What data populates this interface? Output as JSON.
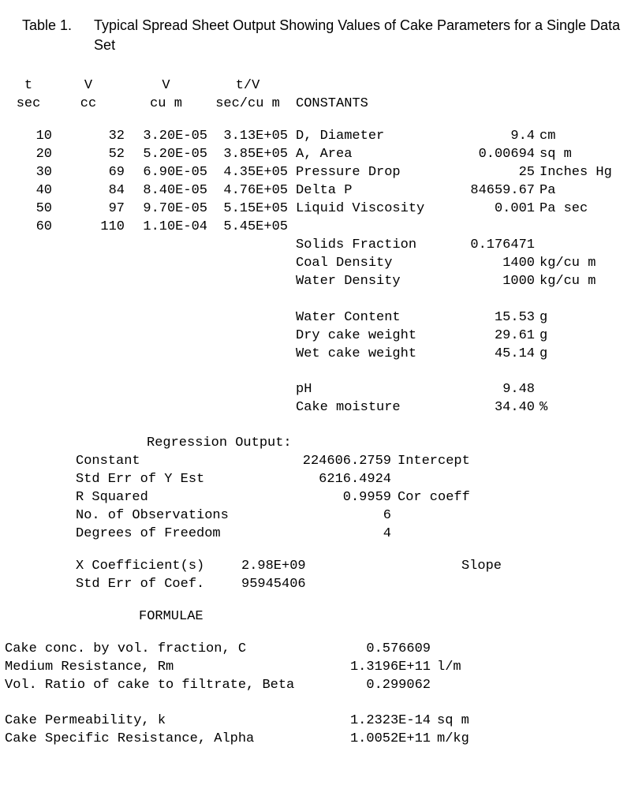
{
  "title": {
    "label": "Table 1.",
    "caption": "Typical Spread Sheet Output Showing Values of Cake Parameters for a Single Data Set"
  },
  "headers": {
    "t1": "t",
    "t2": "sec",
    "v1": "V",
    "v2": "cc",
    "vcum1": "V",
    "vcum2": "cu m",
    "tv1": "t/V",
    "tv2": "sec/cu m",
    "const": "CONSTANTS"
  },
  "rows": [
    {
      "t": "10",
      "vcc": "32",
      "vcum": "3.20E-05",
      "tv": "3.13E+05"
    },
    {
      "t": "20",
      "vcc": "52",
      "vcum": "5.20E-05",
      "tv": "3.85E+05"
    },
    {
      "t": "30",
      "vcc": "69",
      "vcum": "6.90E-05",
      "tv": "4.35E+05"
    },
    {
      "t": "40",
      "vcc": "84",
      "vcum": "8.40E-05",
      "tv": "4.76E+05"
    },
    {
      "t": "50",
      "vcc": "97",
      "vcum": "9.70E-05",
      "tv": "5.15E+05"
    },
    {
      "t": "60",
      "vcc": "110",
      "vcum": "1.10E-04",
      "tv": "5.45E+05"
    }
  ],
  "constants": [
    {
      "name": "D, Diameter",
      "value": "9.4",
      "unit": "cm"
    },
    {
      "name": "A, Area",
      "value": "0.00694",
      "unit": "sq m"
    },
    {
      "name": "Pressure Drop",
      "value": "25",
      "unit": "Inches Hg"
    },
    {
      "name": "Delta P",
      "value": "84659.67",
      "unit": "Pa"
    },
    {
      "name": "Liquid Viscosity",
      "value": "0.001",
      "unit": "Pa sec"
    },
    {
      "name": "",
      "value": "",
      "unit": ""
    },
    {
      "name": "Solids Fraction",
      "value": "0.176471",
      "unit": ""
    },
    {
      "name": "Coal Density",
      "value": "1400",
      "unit": "kg/cu m"
    },
    {
      "name": "Water Density",
      "value": "1000",
      "unit": "kg/cu m"
    },
    {
      "name": "",
      "value": "",
      "unit": ""
    },
    {
      "name": "Water Content",
      "value": "15.53",
      "unit": "g"
    },
    {
      "name": "Dry cake weight",
      "value": "29.61",
      "unit": "g"
    },
    {
      "name": "Wet cake weight",
      "value": "45.14",
      "unit": "g"
    },
    {
      "name": "",
      "value": "",
      "unit": ""
    },
    {
      "name": "pH",
      "value": "9.48",
      "unit": ""
    },
    {
      "name": "Cake moisture",
      "value": "34.40",
      "unit": "%"
    }
  ],
  "reg": {
    "title": "Regression Output:",
    "rows": [
      {
        "name": "Constant",
        "value": "224606.2759",
        "note": "Intercept"
      },
      {
        "name": "Std Err of Y Est",
        "value": "6216.4924",
        "note": ""
      },
      {
        "name": "R Squared",
        "value": "0.9959",
        "note": "Cor coeff"
      },
      {
        "name": "No. of Observations",
        "value": "6",
        "note": ""
      },
      {
        "name": "Degrees of Freedom",
        "value": "4",
        "note": ""
      }
    ],
    "xrows": [
      {
        "name": "X Coefficient(s)",
        "value": "2.98E+09",
        "note": "Slope"
      },
      {
        "name": "Std Err of Coef.",
        "value": "95945406",
        "note": ""
      }
    ]
  },
  "formulae": {
    "title": "FORMULAE",
    "rows": [
      {
        "name": "Cake conc. by vol. fraction, C",
        "value": "0.576609",
        "unit": ""
      },
      {
        "name": "Medium Resistance, Rm",
        "value": "1.3196E+11",
        "unit": "l/m"
      },
      {
        "name": "Vol. Ratio of cake to filtrate, Beta",
        "value": "0.299062",
        "unit": ""
      },
      {
        "name": "",
        "value": "",
        "unit": ""
      },
      {
        "name": "Cake Permeability, k",
        "value": "1.2323E-14",
        "unit": "sq m"
      },
      {
        "name": "Cake Specific Resistance, Alpha",
        "value": "1.0052E+11",
        "unit": "m/kg"
      }
    ]
  }
}
